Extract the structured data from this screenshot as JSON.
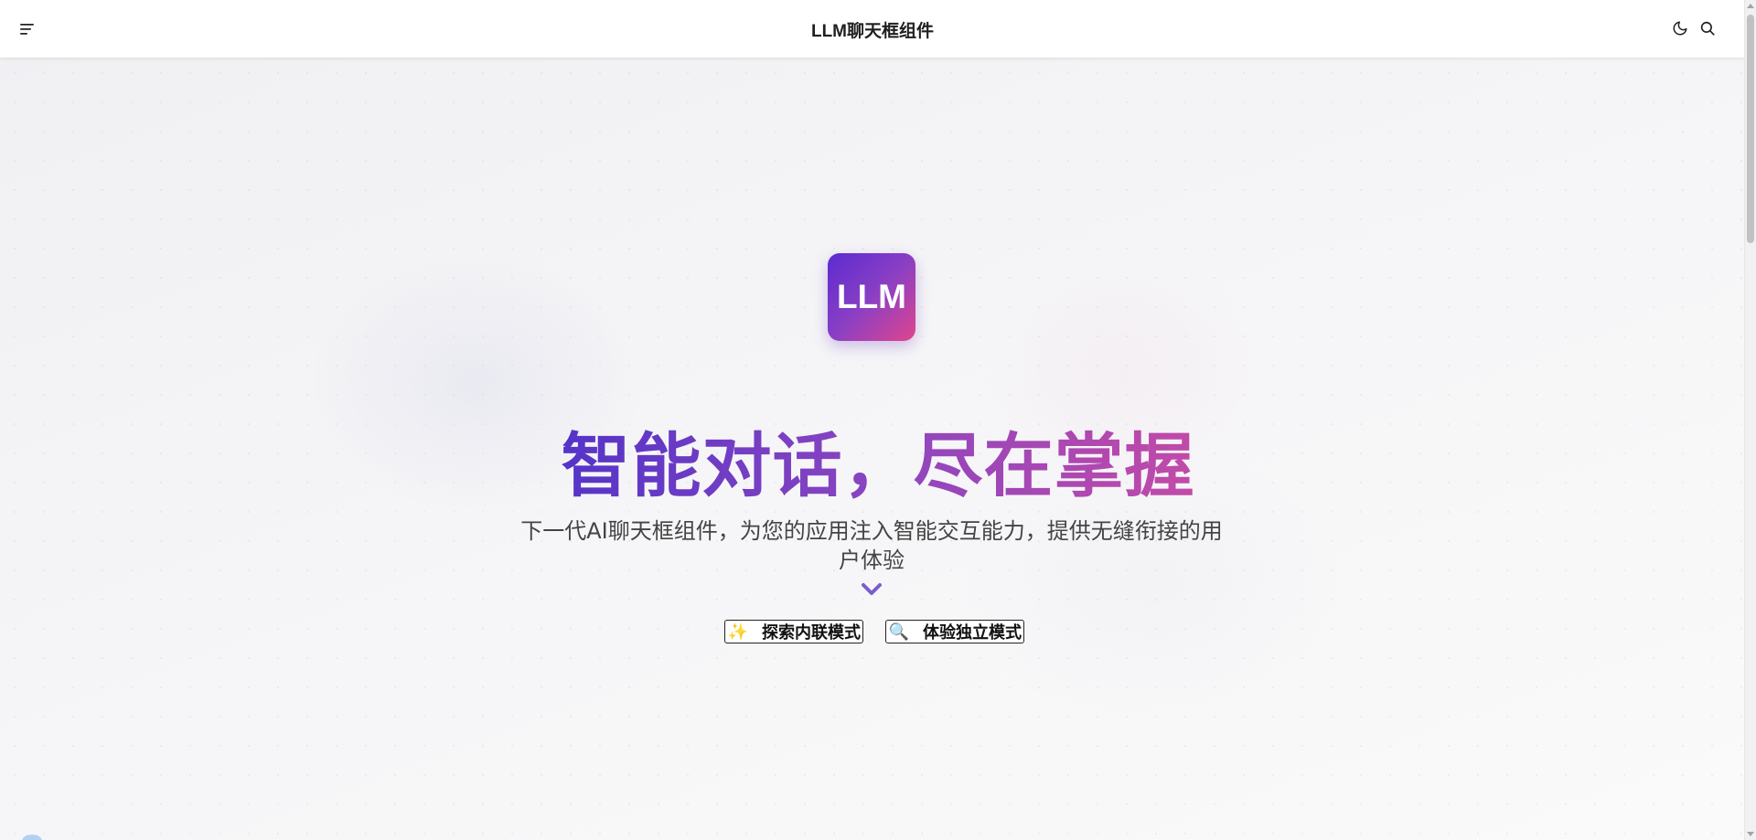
{
  "header": {
    "title": "LLM聊天框组件",
    "menu_icon": "menu-icon",
    "theme_icon": "moon-icon",
    "search_icon": "search-icon"
  },
  "hero": {
    "logo_text": "LLM",
    "headline": "智能对话，尽在掌握",
    "subtitle": "下一代AI聊天框组件，为您的应用注入智能交互能力，提供无缝衔接的用户体验",
    "scroll_hint_icon": "chevron-down-icon",
    "buttons": [
      {
        "icon": "sparkles-icon",
        "glyph": "✨",
        "label": "探索内联模式"
      },
      {
        "icon": "magnifier-icon",
        "glyph": "🔍",
        "label": "体验独立模式"
      }
    ]
  },
  "colors": {
    "brand_gradient_start": "#5b2bd1",
    "brand_gradient_end": "#e0458c",
    "headline_gradient_start": "#5534c8",
    "headline_gradient_end": "#c24aa8"
  }
}
